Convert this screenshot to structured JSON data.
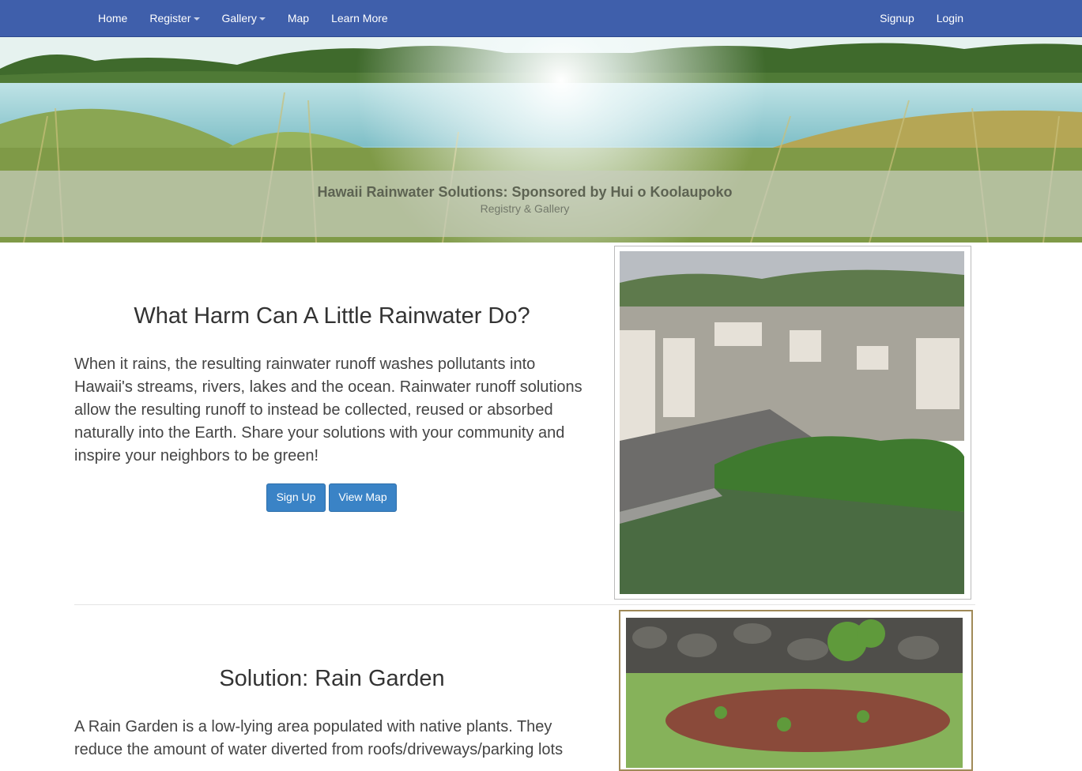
{
  "navbar": {
    "left_items": [
      {
        "label": "Home",
        "dropdown": false
      },
      {
        "label": "Register",
        "dropdown": true
      },
      {
        "label": "Gallery",
        "dropdown": true
      },
      {
        "label": "Map",
        "dropdown": false
      },
      {
        "label": "Learn More",
        "dropdown": false
      }
    ],
    "right_items": [
      {
        "label": "Signup"
      },
      {
        "label": "Login"
      }
    ],
    "bg_color": "#3f5fab"
  },
  "hero": {
    "title": "Hawaii Rainwater Solutions: Sponsored by Hui o Koolaupoko",
    "subtitle": "Registry & Gallery"
  },
  "section1": {
    "heading": "What Harm Can A Little Rainwater Do?",
    "body": "When it rains, the resulting rainwater runoff washes pollutants into Hawaii's streams, rivers, lakes and the ocean. Rainwater runoff solutions allow the resulting runoff to instead be collected, reused or absorbed naturally into the Earth. Share your solutions with your community and inspire your neighbors to be green!",
    "buttons": {
      "signup": "Sign Up",
      "view_map": "View Map"
    },
    "button_color": "#3a83c6"
  },
  "section2": {
    "heading": "Solution: Rain Garden",
    "body": "A Rain Garden is a low-lying area populated with native plants. They reduce the amount of water diverted from roofs/driveways/parking lots"
  }
}
